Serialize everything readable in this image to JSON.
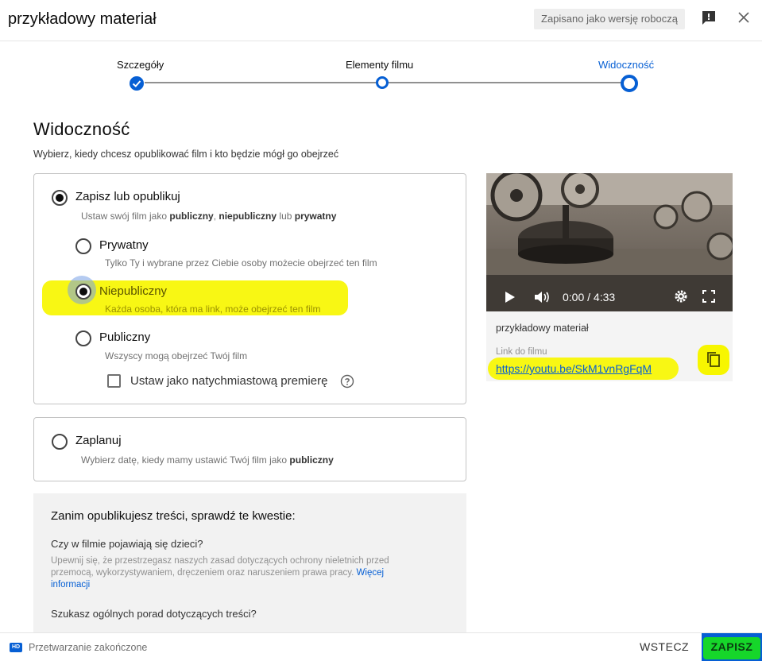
{
  "header": {
    "title": "przykładowy materiał",
    "draft_badge": "Zapisano jako wersję roboczą"
  },
  "stepper": {
    "steps": [
      {
        "label": "Szczegóły",
        "state": "done"
      },
      {
        "label": "Elementy filmu",
        "state": "todo"
      },
      {
        "label": "Widoczność",
        "state": "active"
      }
    ]
  },
  "visibility": {
    "heading": "Widoczność",
    "subtitle": "Wybierz, kiedy chcesz opublikować film i kto będzie mógł go obejrzeć",
    "save_publish": {
      "label": "Zapisz lub opublikuj",
      "desc_parts": [
        "Ustaw swój film jako ",
        "publiczny",
        ", ",
        "niepubliczny",
        " lub ",
        "prywatny"
      ],
      "selected": true
    },
    "options": [
      {
        "label": "Prywatny",
        "desc": "Tylko Ty i wybrane przez Ciebie osoby możecie obejrzeć ten film",
        "selected": false
      },
      {
        "label": "Niepubliczny",
        "desc": "Każda osoba, która ma link, może obejrzeć ten film",
        "selected": true
      },
      {
        "label": "Publiczny",
        "desc": "Wszyscy mogą obejrzeć Twój film",
        "selected": false
      }
    ],
    "premiere_checkbox": {
      "label": "Ustaw jako natychmiastową premierę",
      "checked": false
    },
    "schedule": {
      "label": "Zaplanuj",
      "desc_prefix": "Wybierz datę, kiedy mamy ustawić Twój film jako ",
      "desc_bold": "publiczny",
      "selected": false
    }
  },
  "notice": {
    "title": "Zanim opublikujesz treści, sprawdź te kwestie:",
    "q1": "Czy w filmie pojawiają się dzieci?",
    "body": "Upewnij się, że przestrzegasz naszych zasad dotyczących ochrony nieletnich przed przemocą, wykorzystywaniem, dręczeniem oraz naruszeniem prawa pracy.",
    "link": "Więcej informacji",
    "q2": "Szukasz ogólnych porad dotyczących treści?"
  },
  "video": {
    "time": "0:00 / 4:33",
    "title": "przykładowy materiał",
    "link_label": "Link do filmu",
    "link_url": "https://youtu.be/SkM1vnRgFqM"
  },
  "footer": {
    "hd": "HD",
    "status": "Przetwarzanie zakończone",
    "back": "WSTECZ",
    "save": "ZAPISZ"
  },
  "colors": {
    "accent": "#065fd4",
    "highlight_yellow": "#f7f600",
    "highlight_green": "#16d62a"
  }
}
